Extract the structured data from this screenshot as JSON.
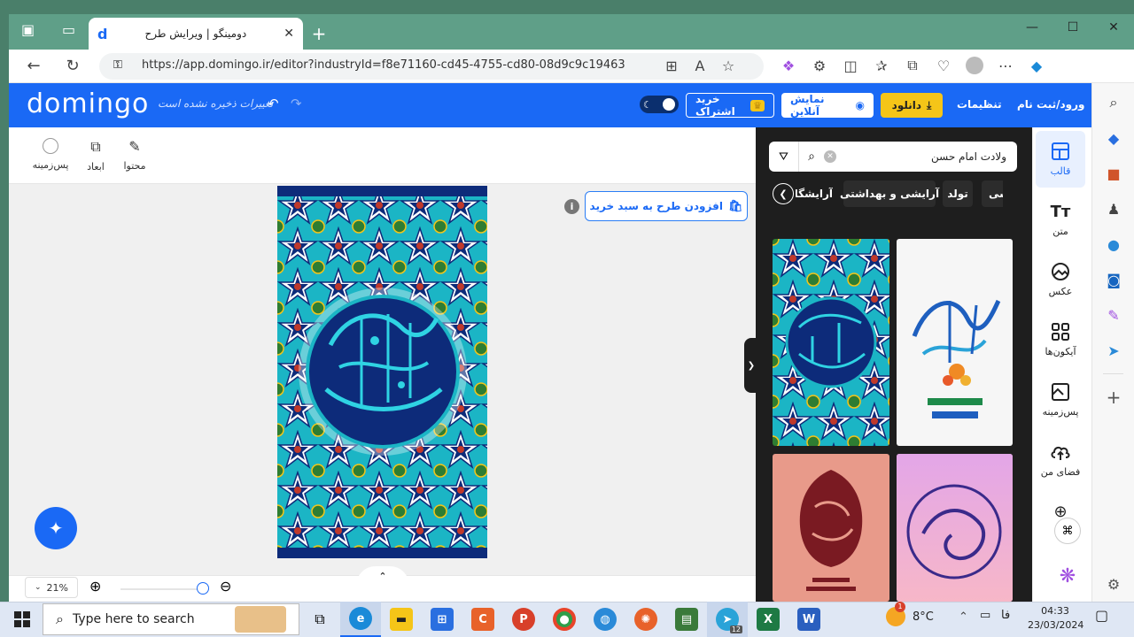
{
  "browser": {
    "tab_title": "دومینگو | ویرایش طرح",
    "url": "https://app.domingo.ir/editor?industryId=f8e71160-cd45-4755-cd80-08d9c9c19463"
  },
  "header": {
    "logo": "domingo",
    "save_status": "تغییرات ذخیره نشده است",
    "login": "ورود/ثبت نام",
    "settings": "تنظیمات",
    "download": "دانلود",
    "online_view": "نمایش آنلاین",
    "buy_subscription": "خرید اشتراک"
  },
  "toolbar": {
    "content": "محتوا",
    "dimensions": "ابعاد",
    "background": "پس‌زمینه"
  },
  "canvas": {
    "add_to_cart": "افزودن طرح به سبد خرید",
    "info": "i",
    "zoom": "21%"
  },
  "panel": {
    "search_value": "ولادت امام حسن",
    "chips": [
      "شی",
      "تولد",
      "آرایشی و بهداشتی",
      "آرایشگاه"
    ]
  },
  "sidenav": {
    "items": [
      {
        "label": "قالب",
        "icon": "template-icon"
      },
      {
        "label": "متن",
        "icon": "text-icon"
      },
      {
        "label": "عکس",
        "icon": "image-icon"
      },
      {
        "label": "آیکون‌ها",
        "icon": "icons-grid-icon"
      },
      {
        "label": "پس‌زمینه",
        "icon": "background-icon"
      },
      {
        "label": "فضای من",
        "icon": "cloud-upload-icon"
      }
    ]
  },
  "taskbar": {
    "search_placeholder": "Type here to search",
    "temperature": "8°C",
    "language": "فا",
    "time": "04:33",
    "date": "23/03/2024",
    "weather_badge": "1",
    "telegram_badge": "12"
  },
  "colors": {
    "brand_blue": "#1a69f5",
    "download_yellow": "#f5c518",
    "panel_dark": "#1e1e1e",
    "browser_green": "#5f9f88"
  }
}
